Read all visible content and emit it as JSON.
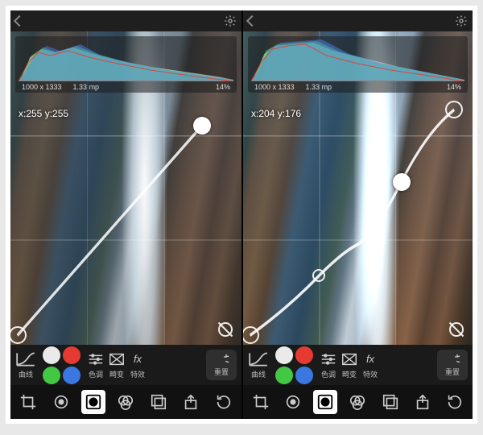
{
  "panes": [
    {
      "meta": {
        "dimensions": "1000 x 1333",
        "megapixels": "1.33 mp",
        "percent": "14%"
      },
      "coord": "x:255 y:255"
    },
    {
      "meta": {
        "dimensions": "1000 x 1333",
        "megapixels": "1.33 mp",
        "percent": "14%"
      },
      "coord": "x:204 y:176"
    }
  ],
  "tools": {
    "curves_label": "曲线",
    "tone_label": "色调",
    "gradient_label": "畸变",
    "fx_glyph": "fx",
    "fx_label": "特效",
    "reset_label": "重置"
  },
  "swatches": {
    "white": "#eaeaea",
    "red": "#e53a32",
    "green": "#43c843",
    "blue": "#3a78e0"
  }
}
